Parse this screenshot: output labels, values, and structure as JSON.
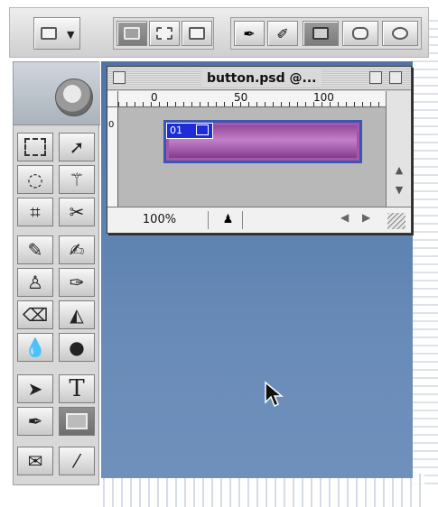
{
  "options_bar": {
    "tool_preset": "rectangle-shape-icon",
    "mode_buttons": [
      "shape-layers-icon",
      "paths-icon",
      "fill-pixels-icon"
    ],
    "pen_tools": [
      "pen-icon",
      "freeform-pen-icon"
    ],
    "shapes": [
      "rectangle-icon",
      "rounded-rectangle-icon",
      "ellipse-icon"
    ]
  },
  "document": {
    "title": "button.psd @...",
    "zoom": "100%",
    "ruler_h": [
      "0",
      "50",
      "100"
    ],
    "ruler_v": [
      "0"
    ],
    "layer_label": "01",
    "shape_fill": "#b06cb8",
    "shape_border": "#3b56b3"
  },
  "toolbox": {
    "tools": [
      "marquee-icon",
      "move-icon",
      "lasso-icon",
      "magic-wand-icon",
      "crop-icon",
      "slice-icon",
      "healing-brush-icon",
      "brush-icon",
      "clone-stamp-icon",
      "history-brush-icon",
      "eraser-icon",
      "paint-bucket-icon",
      "blur-icon",
      "dodge-icon",
      "path-selection-icon",
      "type-icon",
      "pen-icon",
      "rectangle-shape-icon",
      "notes-icon",
      "eyedropper-icon"
    ],
    "type_tool_label": "T"
  },
  "colors": {
    "workspace": "#5c81b0",
    "panel": "#d8d8d8"
  }
}
